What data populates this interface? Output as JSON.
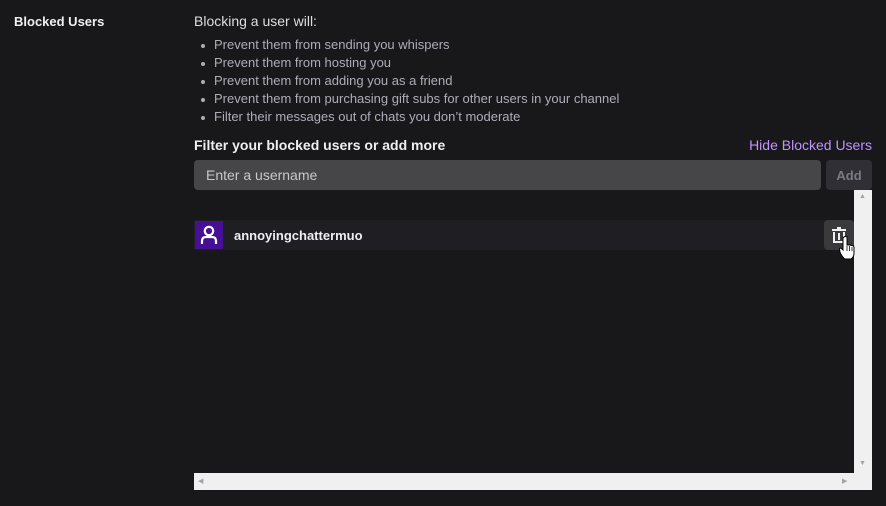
{
  "section": {
    "label": "Blocked Users"
  },
  "intro": "Blocking a user will:",
  "rules": [
    "Prevent them from sending you whispers",
    "Prevent them from hosting you",
    "Prevent them from adding you as a friend",
    "Prevent them from purchasing gift subs for other users in your channel",
    "Filter their messages out of chats you don’t moderate"
  ],
  "filter": {
    "label": "Filter your blocked users or add more",
    "hide_link": "Hide Blocked Users",
    "placeholder": "Enter a username",
    "add_label": "Add"
  },
  "blocked": [
    {
      "username": "annoyingchattermuo",
      "avatar_icon": "user-icon",
      "remove_icon": "trash-icon"
    }
  ],
  "colors": {
    "accent": "#bf94ff",
    "avatar_bg": "#451093",
    "background": "#18181b"
  }
}
